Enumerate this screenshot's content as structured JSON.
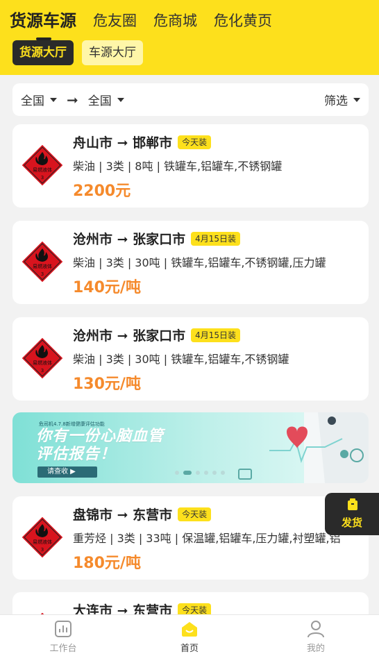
{
  "header": {
    "tabs": [
      {
        "label": "货源车源"
      },
      {
        "label": "危友圈"
      },
      {
        "label": "危商城"
      },
      {
        "label": "危化黄页"
      }
    ],
    "sub_tabs": [
      {
        "label": "货源大厅"
      },
      {
        "label": "车源大厅"
      }
    ]
  },
  "filter": {
    "from": "全国",
    "arrow": "➞",
    "to": "全国",
    "filter_label": "筛选"
  },
  "hazard_label": {
    "line1": "易燃液体",
    "line2": "3"
  },
  "listings": [
    {
      "route": "舟山市 ➞ 邯郸市",
      "tag": "今天装",
      "detail": "柴油 | 3类 | 8吨 | 铁罐车,铝罐车,不锈钢罐",
      "price": "2200元"
    },
    {
      "route": "沧州市 ➞ 张家口市",
      "tag": "4月15日装",
      "detail": "柴油 | 3类 | 30吨 | 铁罐车,铝罐车,不锈钢罐,压力罐",
      "price": "140元/吨"
    },
    {
      "route": "沧州市 ➞ 张家口市",
      "tag": "4月15日装",
      "detail": "柴油 | 3类 | 30吨 | 铁罐车,铝罐车,不锈钢罐",
      "price": "130元/吨"
    },
    {
      "route": "盘锦市 ➞ 东营市",
      "tag": "今天装",
      "detail": "重芳烃 | 3类 | 33吨 | 保温罐,铝罐车,压力罐,衬塑罐,铝",
      "price": "180元/吨"
    },
    {
      "route": "大连市 ➞ 东营市",
      "tag": "今天装",
      "detail": "",
      "price": ""
    }
  ],
  "banner": {
    "small_text": "危司机4.7.8新增健康评估功能",
    "title_line1": "你有一份心脑血管",
    "title_line2": "评估报告！",
    "button": "请查收 ▶"
  },
  "float_button": {
    "label": "发货"
  },
  "bottom_nav": [
    {
      "label": "工作台",
      "icon": "chart-icon"
    },
    {
      "label": "首页",
      "icon": "home-icon"
    },
    {
      "label": "我的",
      "icon": "user-icon"
    }
  ],
  "colors": {
    "accent": "#fde01c",
    "price": "#f58a2c",
    "dark": "#2a2a2a",
    "hazard": "#d8141e"
  }
}
